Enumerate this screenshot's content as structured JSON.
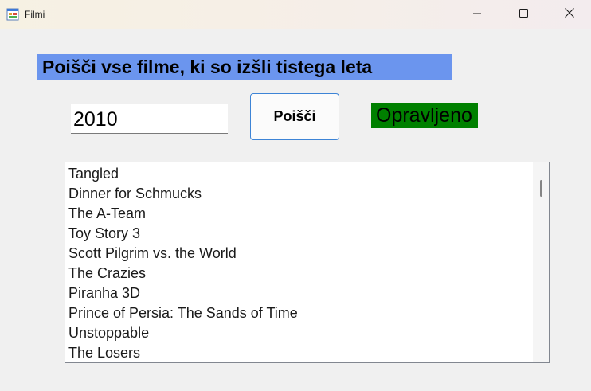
{
  "window": {
    "title": "Filmi",
    "controls": [
      "minimize",
      "maximize",
      "close"
    ]
  },
  "form": {
    "heading": "Poišči vse filme, ki so izšli tistega leta",
    "year_input": {
      "value": "2010",
      "placeholder": ""
    },
    "search_button": "Poišči",
    "status": "Opravljeno"
  },
  "movies": [
    "Tangled",
    "Dinner for Schmucks",
    "The A-Team",
    "Toy Story 3",
    "Scott Pilgrim vs. the World",
    "The Crazies",
    "Piranha 3D",
    "Prince of Persia: The Sands of Time",
    "Unstoppable",
    "The Losers"
  ],
  "colors": {
    "heading_bg": "#6b95ee",
    "status_bg": "#008000",
    "window_bg": "#f0f0f0",
    "button_border": "#3d84d6"
  },
  "icons": {
    "app": "form-icon",
    "minimize": "minimize-icon",
    "maximize": "maximize-icon",
    "close": "close-icon"
  }
}
